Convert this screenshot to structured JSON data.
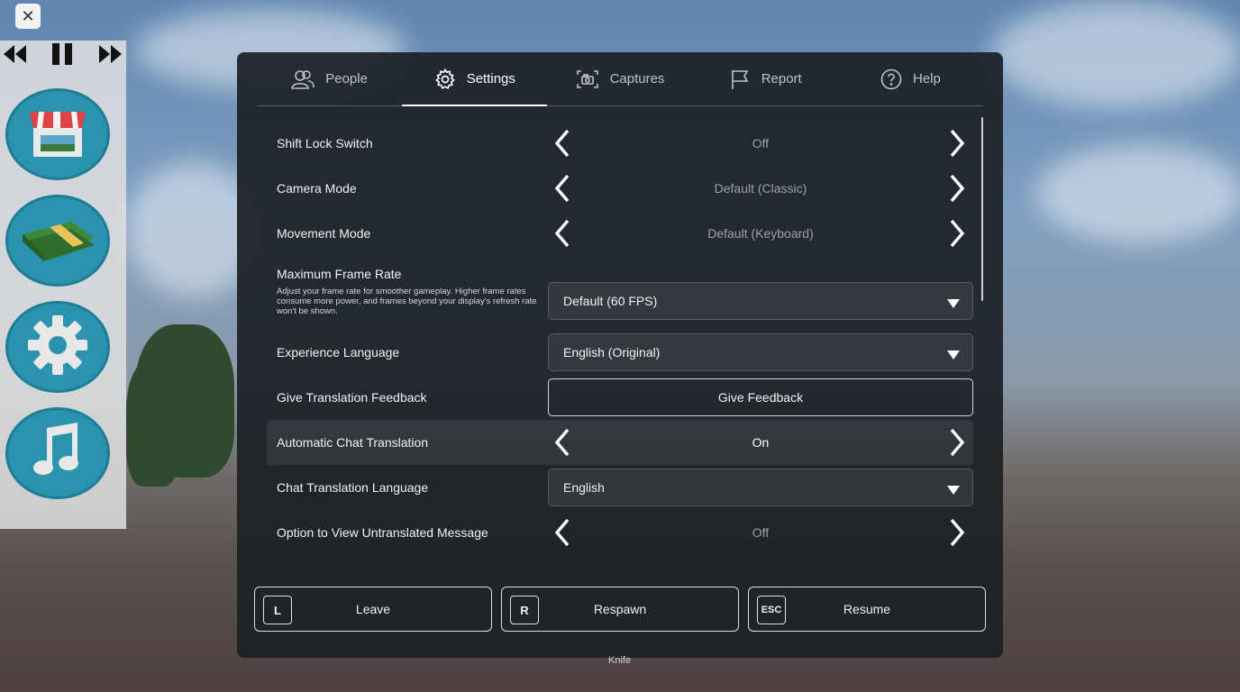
{
  "overlay": {
    "close_symbol": "✕",
    "hotbar_hint": "Knife"
  },
  "side_menu": {
    "media": [
      {
        "icon": "rewind-icon"
      },
      {
        "icon": "pause-icon"
      },
      {
        "icon": "fast-forward-icon"
      }
    ],
    "buttons": [
      {
        "icon": "shop-icon"
      },
      {
        "icon": "cash-icon"
      },
      {
        "icon": "gear-icon"
      },
      {
        "icon": "music-note-icon"
      }
    ]
  },
  "tabs": [
    {
      "label": "People",
      "icon": "people-icon",
      "active": false
    },
    {
      "label": "Settings",
      "icon": "gear-icon",
      "active": true
    },
    {
      "label": "Captures",
      "icon": "camera-icon",
      "active": false
    },
    {
      "label": "Report",
      "icon": "flag-icon",
      "active": false
    },
    {
      "label": "Help",
      "icon": "help-icon",
      "active": false
    }
  ],
  "settings": {
    "shift_lock": {
      "label": "Shift Lock Switch",
      "value": "Off"
    },
    "camera_mode": {
      "label": "Camera Mode",
      "value": "Default (Classic)"
    },
    "movement_mode": {
      "label": "Movement Mode",
      "value": "Default (Keyboard)"
    },
    "max_frame_rate": {
      "label": "Maximum Frame Rate",
      "description": "Adjust your frame rate for smoother gameplay. Higher frame rates consume more power, and frames beyond your display's refresh rate won't be shown.",
      "value": "Default (60 FPS)"
    },
    "experience_language": {
      "label": "Experience Language",
      "value": "English (Original)"
    },
    "translation_feedback": {
      "label": "Give Translation Feedback",
      "button": "Give Feedback"
    },
    "auto_chat_translation": {
      "label": "Automatic Chat Translation",
      "value": "On"
    },
    "chat_translation_language": {
      "label": "Chat Translation Language",
      "value": "English"
    },
    "view_untranslated": {
      "label": "Option to View Untranslated Message",
      "value": "Off"
    }
  },
  "actions": {
    "leave": {
      "key": "L",
      "label": "Leave"
    },
    "respawn": {
      "key": "R",
      "label": "Respawn"
    },
    "resume": {
      "key": "ESC",
      "label": "Resume"
    }
  },
  "colors": {
    "panel": "#1c2026",
    "side_button": "#2a93ad",
    "muted_value": "#9da1a6"
  }
}
